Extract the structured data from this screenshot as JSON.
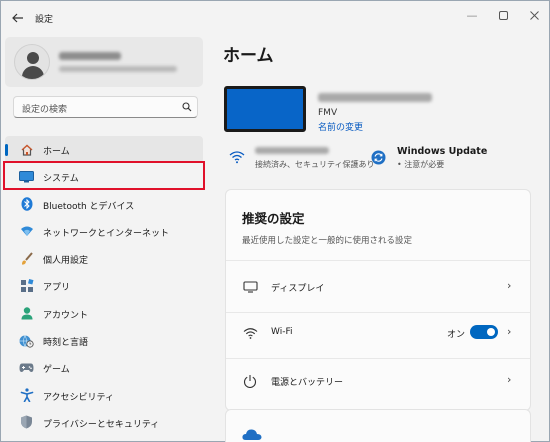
{
  "window": {
    "title": "設定",
    "controls": {
      "minimize": "—",
      "maximize": "☐",
      "close": "✕"
    }
  },
  "search": {
    "placeholder": "設定の検索"
  },
  "sidebar": {
    "items": [
      {
        "label": "ホーム",
        "icon": "home-icon",
        "active": true
      },
      {
        "label": "システム",
        "icon": "monitor-icon"
      },
      {
        "label": "Bluetooth とデバイス",
        "icon": "bluetooth-icon"
      },
      {
        "label": "ネットワークとインターネット",
        "icon": "wifi-diamond-icon"
      },
      {
        "label": "個人用設定",
        "icon": "brush-icon"
      },
      {
        "label": "アプリ",
        "icon": "apps-icon"
      },
      {
        "label": "アカウント",
        "icon": "account-icon"
      },
      {
        "label": "時刻と言語",
        "icon": "globe-clock-icon"
      },
      {
        "label": "ゲーム",
        "icon": "gamepad-icon"
      },
      {
        "label": "アクセシビリティ",
        "icon": "accessibility-icon"
      },
      {
        "label": "プライバシーとセキュリティ",
        "icon": "shield-icon"
      }
    ]
  },
  "main": {
    "title": "ホーム",
    "device": {
      "model": "FMV",
      "rename_label": "名前の変更"
    },
    "network_status": {
      "subtitle": "接続済み、セキュリティ保護あり"
    },
    "windows_update": {
      "title": "Windows Update",
      "subtitle": "• 注意が必要"
    },
    "recommended": {
      "title": "推奨の設定",
      "subtitle": "最近使用した設定と一般的に使用される設定",
      "rows": [
        {
          "label": "ディスプレイ",
          "icon": "display-icon"
        },
        {
          "label": "Wi-Fi",
          "icon": "wifi-icon",
          "toggle_label": "オン",
          "toggle_on": true
        },
        {
          "label": "電源とバッテリー",
          "icon": "power-icon"
        }
      ]
    }
  },
  "colors": {
    "accent": "#0067c0",
    "highlight": "#e0102a",
    "device_screen": "#0865c8"
  }
}
